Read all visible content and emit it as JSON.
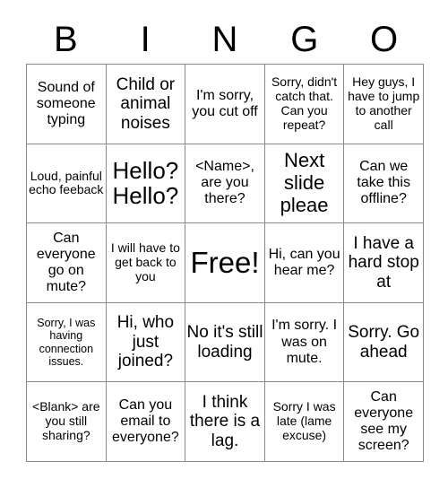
{
  "card": {
    "title": "BINGO",
    "header_letters": [
      "B",
      "I",
      "N",
      "G",
      "O"
    ],
    "colors": {
      "background": "#ffffff",
      "text": "#000000",
      "border": "#8a8a8a"
    },
    "rows": [
      [
        {
          "text": "Sound of someone typing",
          "size": "md"
        },
        {
          "text": "Child or animal noises",
          "size": "lg"
        },
        {
          "text": "I'm sorry, you cut off",
          "size": "md"
        },
        {
          "text": "Sorry, didn't catch that. Can you repeat?",
          "size": "sm"
        },
        {
          "text": "Hey guys, I have to jump to another call",
          "size": "sm"
        }
      ],
      [
        {
          "text": "Loud, painful echo feeback",
          "size": "sm"
        },
        {
          "text": "Hello? Hello?",
          "size": "xxl"
        },
        {
          "text": "<Name>, are you there?",
          "size": "md"
        },
        {
          "text": "Next slide pleae",
          "size": "xl"
        },
        {
          "text": "Can we take this offline?",
          "size": "md"
        }
      ],
      [
        {
          "text": "Can everyone go on mute?",
          "size": "md"
        },
        {
          "text": "I will have to get back to you",
          "size": "sm"
        },
        {
          "text": "Free!",
          "size": "free"
        },
        {
          "text": "Hi, can you hear me?",
          "size": "md"
        },
        {
          "text": "I have a hard stop at",
          "size": "lg"
        }
      ],
      [
        {
          "text": "Sorry, I was having connection issues.",
          "size": "xs"
        },
        {
          "text": "Hi, who just joined?",
          "size": "lg"
        },
        {
          "text": "No it's still loading",
          "size": "lg"
        },
        {
          "text": "I'm sorry. I was on mute.",
          "size": "md"
        },
        {
          "text": "Sorry. Go ahead",
          "size": "lg"
        }
      ],
      [
        {
          "text": "<Blank> are you still sharing?",
          "size": "sm"
        },
        {
          "text": "Can you email to everyone?",
          "size": "md"
        },
        {
          "text": "I think there is a lag.",
          "size": "lg"
        },
        {
          "text": "Sorry I was late (lame excuse)",
          "size": "sm"
        },
        {
          "text": "Can everyone see my screen?",
          "size": "md"
        }
      ]
    ]
  }
}
